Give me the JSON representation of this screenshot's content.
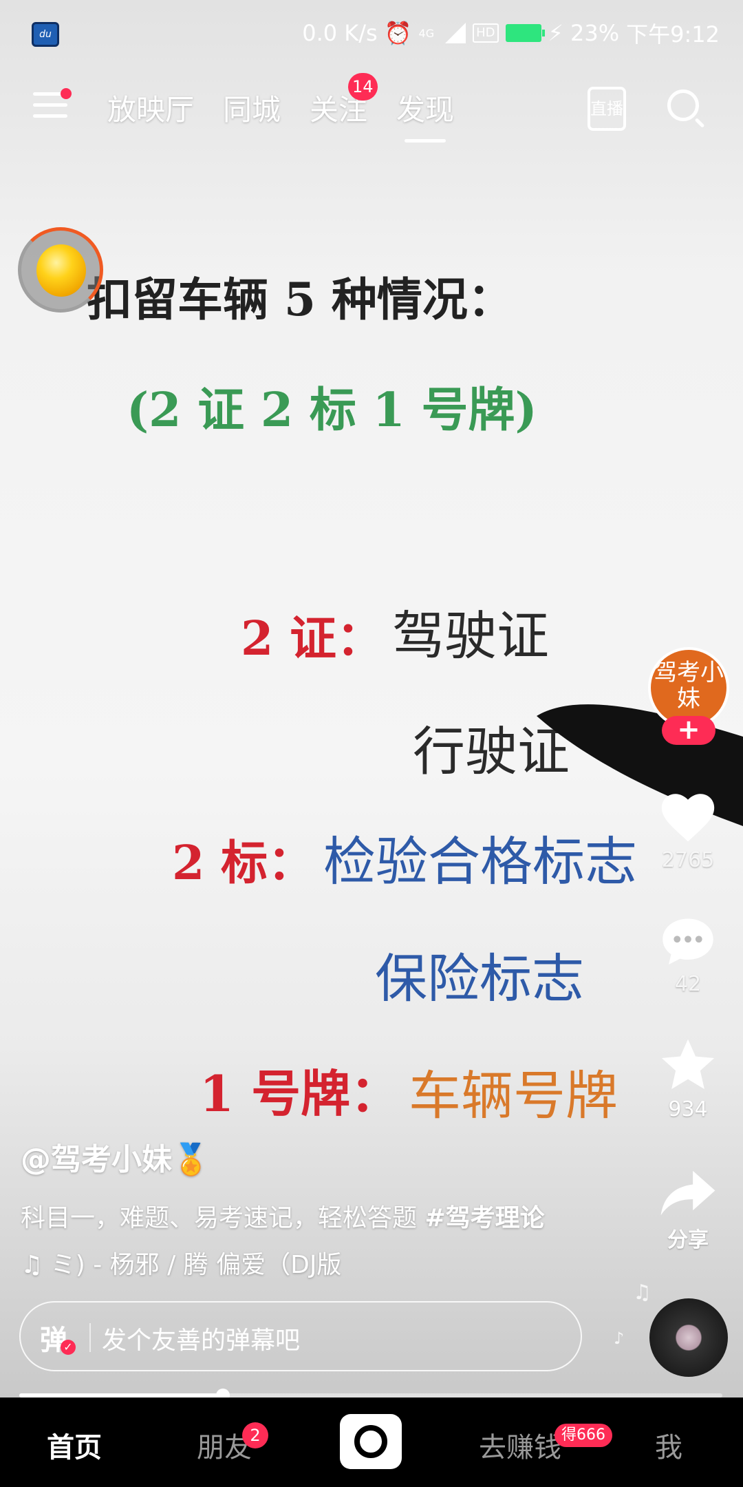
{
  "status_bar": {
    "speed": "0.0 K/s",
    "network": "4G",
    "hd": "HD",
    "battery": "23%",
    "time": "下午9:12"
  },
  "top_nav": {
    "tabs": [
      "放映厅",
      "同城",
      "关注",
      "发现"
    ],
    "active_tab": "发现",
    "follow_badge": "14",
    "live_label": "直播"
  },
  "video": {
    "title": "扣留车辆 5 种情况：",
    "subtitle": "(2 证 2 标 1 号牌)",
    "line1_prefix": "2 证：",
    "line1_value": "驾驶证",
    "line2_value": "行驶证",
    "line3_prefix": "2 标：",
    "line3_value": "检验合格标志",
    "line4_value": "保险标志",
    "line5_prefix": "1 号牌：",
    "line5_value": "车辆号牌"
  },
  "creator": {
    "avatar_text": "驾考小妹",
    "follow_symbol": "+"
  },
  "actions": {
    "likes": "2765",
    "comments": "42",
    "favorites": "934",
    "share_label": "分享"
  },
  "caption": {
    "author": "@驾考小妹🏅",
    "text": "科目一，难题、易考速记，轻松答题 ",
    "hashtag": "#驾考理论",
    "music": "♫ ミ) - 杨邪 / 腾    偏爱（DJ版"
  },
  "danmaku": {
    "icon_label": "弹",
    "placeholder": "发个友善的弹幕吧"
  },
  "progress": {
    "fraction": 0.29
  },
  "bottom_nav": {
    "home": "首页",
    "friends": "朋友",
    "friends_badge": "2",
    "earn": "去赚钱",
    "earn_badge": "得666",
    "me": "我"
  },
  "colors": {
    "accent": "#fe2c55",
    "title_black": "#222222",
    "subtitle_green": "#3a9a55",
    "red": "#d4232f",
    "blue": "#2e5aa8",
    "orange": "#d9792a"
  }
}
